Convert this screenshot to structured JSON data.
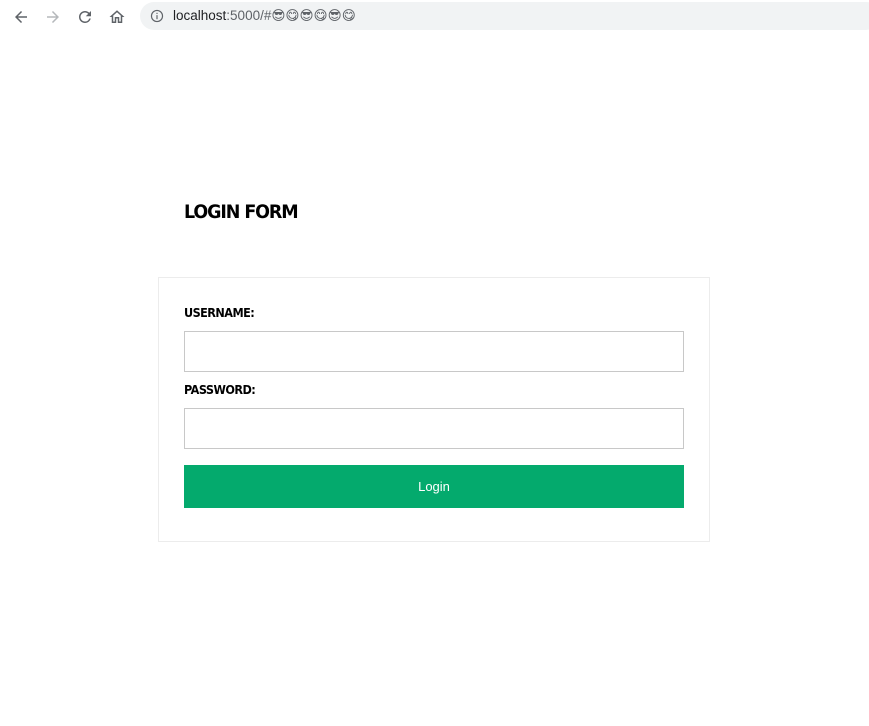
{
  "browser": {
    "url_host": "localhost",
    "url_rest": ":5000/#😎😋😎😋😎😋",
    "icons": {
      "back": "arrow-left-icon",
      "forward": "arrow-right-icon",
      "reload": "reload-icon",
      "home": "home-icon",
      "info": "info-icon"
    }
  },
  "page": {
    "title": "LOGIN FORM"
  },
  "form": {
    "username_label": "USERNAME:",
    "username_value": "",
    "password_label": "PASSWORD:",
    "password_value": "",
    "login_label": "Login",
    "button_color": "#04aa6d"
  }
}
